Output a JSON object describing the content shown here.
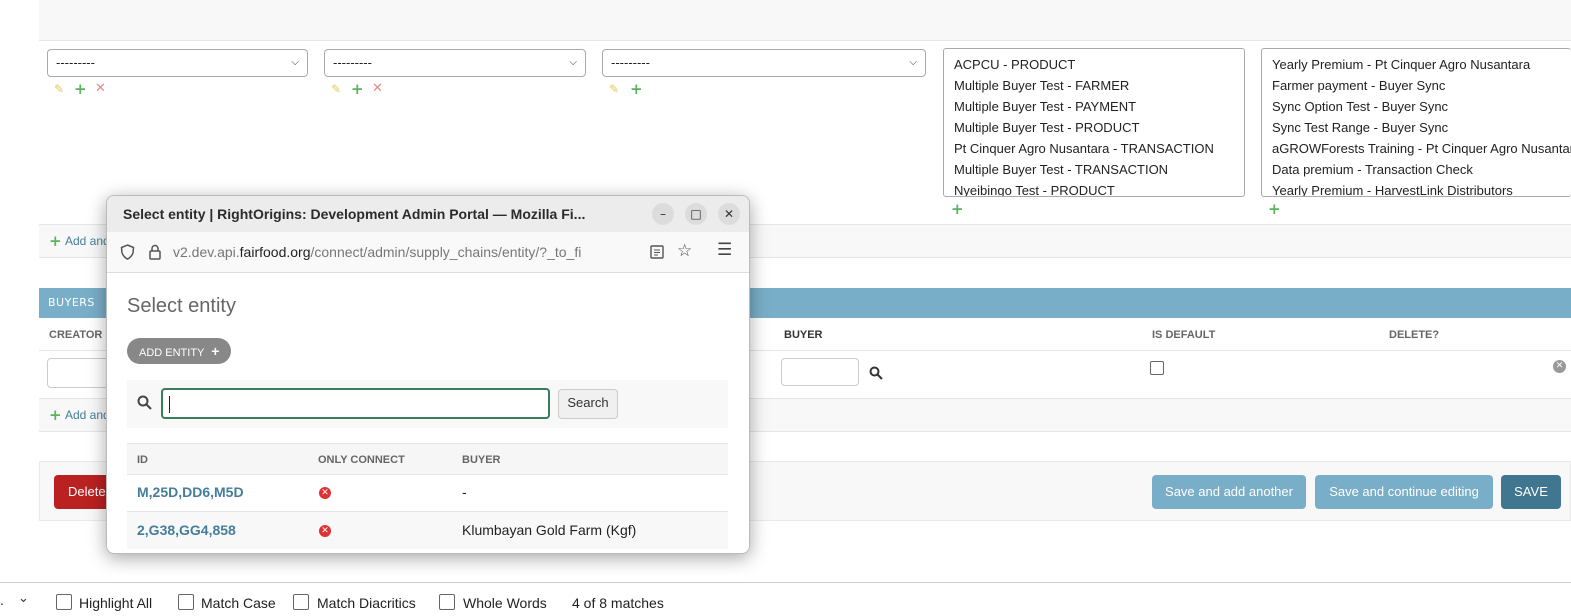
{
  "form": {
    "select1": "---------",
    "select2": "---------",
    "select3": "---------",
    "list1": [
      "ACPCU - PRODUCT",
      "Multiple Buyer Test - FARMER",
      "Multiple Buyer Test - PAYMENT",
      "Multiple Buyer Test - PRODUCT",
      "Pt Cinquer Agro Nusantara - TRANSACTION",
      "Multiple Buyer Test - TRANSACTION",
      "Nyeibingo Test - PRODUCT"
    ],
    "list2": [
      "Yearly Premium - Pt Cinquer Agro Nusantara",
      "Farmer payment - Buyer Sync",
      "Sync Option Test - Buyer Sync",
      "Sync Test Range - Buyer Sync",
      "aGROWForests Training - Pt Cinquer Agro Nusantara",
      "Data premium - Transaction Check",
      "Yearly Premium - HarvestLink Distributors"
    ],
    "add_another_1": "Add and",
    "add_another_2": "Add and"
  },
  "buyers": {
    "section_title": "BUYERS",
    "col_creator": "CREATOR",
    "col_buyer": "BUYER",
    "col_is_default": "IS DEFAULT",
    "col_delete": "DELETE?"
  },
  "submit": {
    "delete": "Delete",
    "save_add": "Save and add another",
    "save_continue": "Save and continue editing",
    "save": "SAVE"
  },
  "popup": {
    "window_title": "Select entity | RightOrigins: Development Admin Portal — Mozilla Fi...",
    "url_prefix": "v2.dev.api.",
    "url_domain": "fairfood.org",
    "url_path": "/connect/admin/supply_chains/entity/?_to_fi",
    "heading": "Select entity",
    "add_entity": "ADD ENTITY",
    "search_value": "",
    "search_button": "Search",
    "col_id": "ID",
    "col_only_connect": "ONLY CONNECT",
    "col_buyer": "BUYER",
    "rows": [
      {
        "id": "M,25D,DD6,M5D",
        "buyer": "-"
      },
      {
        "id": "2,G38,GG4,858",
        "buyer": "Klumbayan Gold Farm (Kgf)"
      }
    ]
  },
  "findbar": {
    "highlight_all": "Highlight All",
    "match_case": "Match Case",
    "match_diacritics": "Match Diacritics",
    "whole_words": "Whole Words",
    "matches": "4 of 8 matches"
  }
}
